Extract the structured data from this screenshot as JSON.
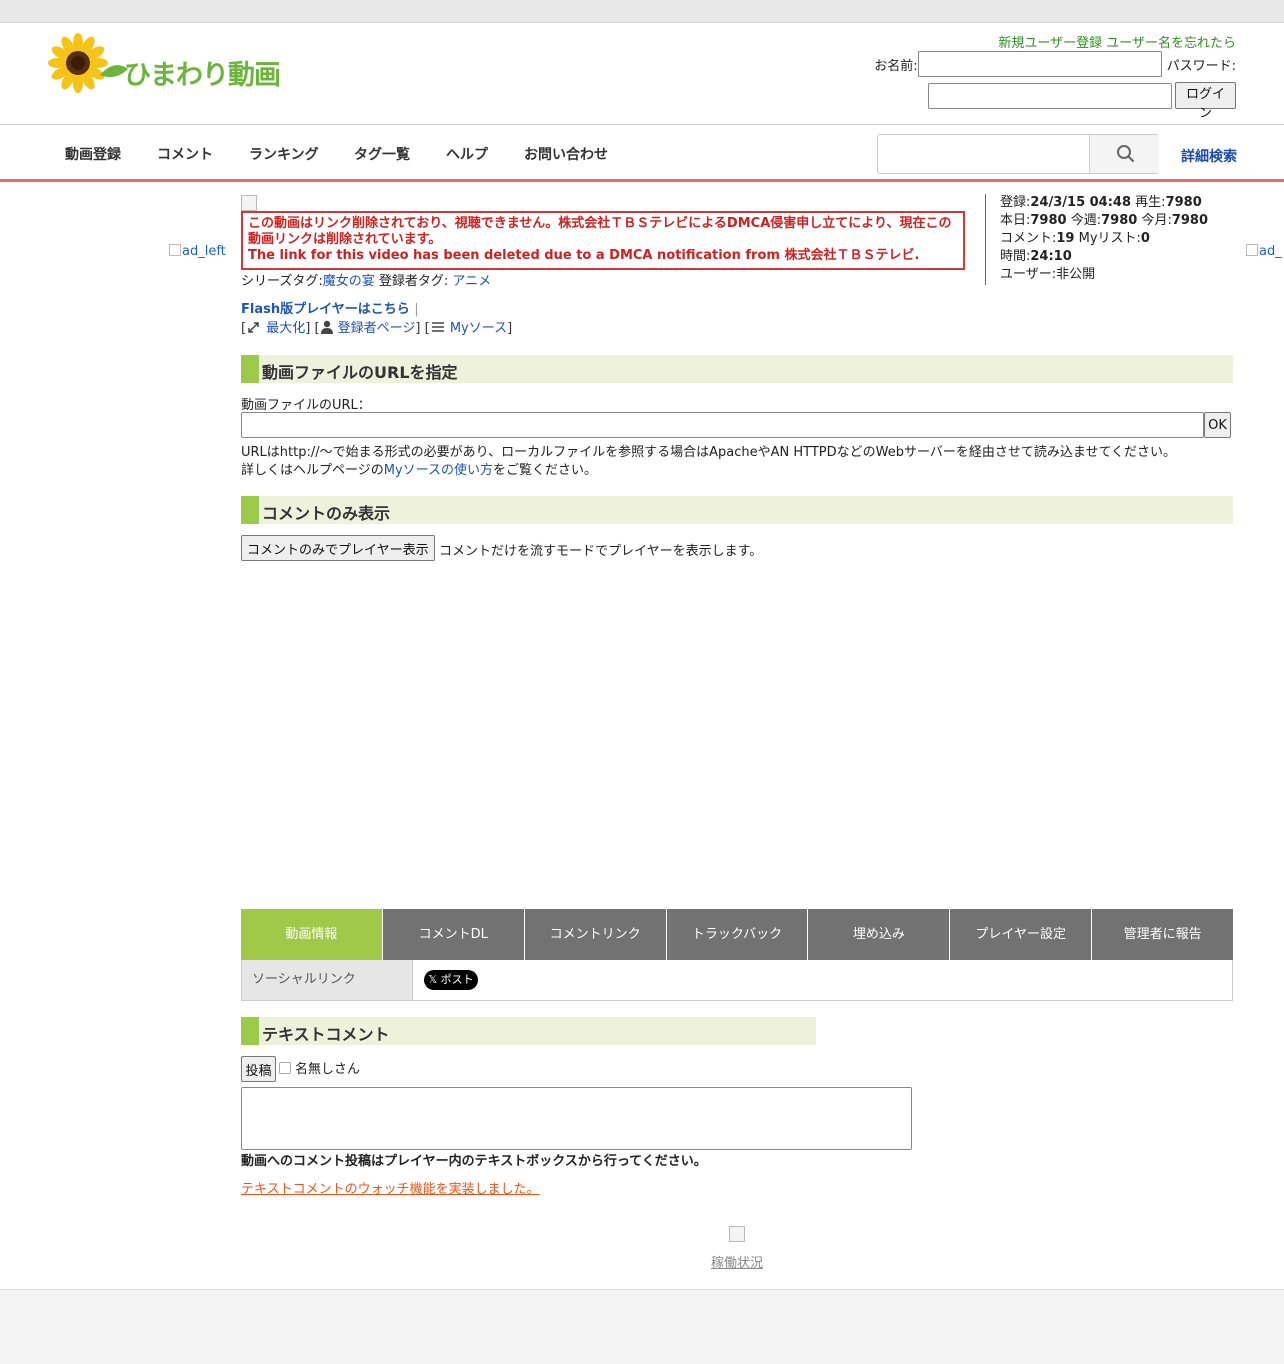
{
  "site": {
    "logo_text": "ひまわり動画"
  },
  "header": {
    "register_link": "新規ユーザー登録",
    "forgot_link": "ユーザー名を忘れたら",
    "name_label": "お名前:",
    "password_label": "パスワード:",
    "login_button": "ログイン"
  },
  "nav": {
    "items": [
      "動画登録",
      "コメント",
      "ランキング",
      "タグ一覧",
      "ヘルプ",
      "お問い合わせ"
    ],
    "advanced_search": "詳細検索"
  },
  "ads": {
    "left": "ad_left",
    "right": "ad_"
  },
  "notice": {
    "line1": "この動画はリンク削除されており、視聴できません。株式会社ＴＢＳテレビによるDMCA侵害申し立てにより、現在この動画リンクは削除されています。",
    "line2": "The link for this video has been deleted due to a DMCA notification from 株式会社ＴＢＳテレビ."
  },
  "tags": {
    "series_label": "シリーズタグ:",
    "series_value": "魔女の宴",
    "user_label": "登録者タグ:",
    "user_value": "アニメ"
  },
  "links": {
    "flash": "Flash版プレイヤーはこちら",
    "flash_sep": "|",
    "maximize": "最大化",
    "uploader_page": "登録者ページ",
    "mysource": "Myソース"
  },
  "stats": {
    "registered_label": "登録:",
    "registered_value": "24/3/15 04:48",
    "plays_label": "再生:",
    "plays_value": "7980",
    "today_label": "本日:",
    "today_value": "7980",
    "week_label": "今週:",
    "week_value": "7980",
    "month_label": "今月:",
    "month_value": "7980",
    "comments_label": "コメント:",
    "comments_value": "19",
    "mylist_label": "Myリスト:",
    "mylist_value": "0",
    "duration_label": "時間:",
    "duration_value": "24:10",
    "user_label": "ユーザー:",
    "user_value": "非公開"
  },
  "url_section": {
    "heading": "動画ファイルのURLを指定",
    "label": "動画ファイルのURL：",
    "input_value": "",
    "ok_button": "OK",
    "help_line1": "URLはhttp://〜で始まる形式の必要があり、ローカルファイルを参照する場合はApacheやAN HTTPDなどのWebサーバーを経由させて読み込ませてください。",
    "help_line2_prefix": "詳しくはヘルプページの",
    "help_link": "Myソースの使い方",
    "help_line2_suffix": "をご覧ください。"
  },
  "comment_only": {
    "heading": "コメントのみ表示",
    "button": "コメントのみでプレイヤー表示",
    "description": "コメントだけを流すモードでプレイヤーを表示します。"
  },
  "tabs": [
    "動画情報",
    "コメントDL",
    "コメントリンク",
    "トラックバック",
    "埋め込み",
    "プレイヤー設定",
    "管理者に報告"
  ],
  "info": {
    "social_label": "ソーシャルリンク",
    "x_button": "𝕏 ポスト"
  },
  "text_comment": {
    "heading": "テキストコメント",
    "post_button": "投稿",
    "anonymous_label": "名無しさん",
    "textarea_value": "",
    "note": "動画へのコメント投稿はプレイヤー内のテキストボックスから行ってください。",
    "watch_link": "テキストコメントのウォッチ機能を実装しました。"
  },
  "footer": {
    "status_link": "稼働状況"
  },
  "colors": {
    "accent_green": "#9ccb4b",
    "nav_border": "#e86a6a",
    "notice_red": "#cc2222",
    "link_blue": "#1e55b3",
    "tab_gray": "#727272"
  }
}
